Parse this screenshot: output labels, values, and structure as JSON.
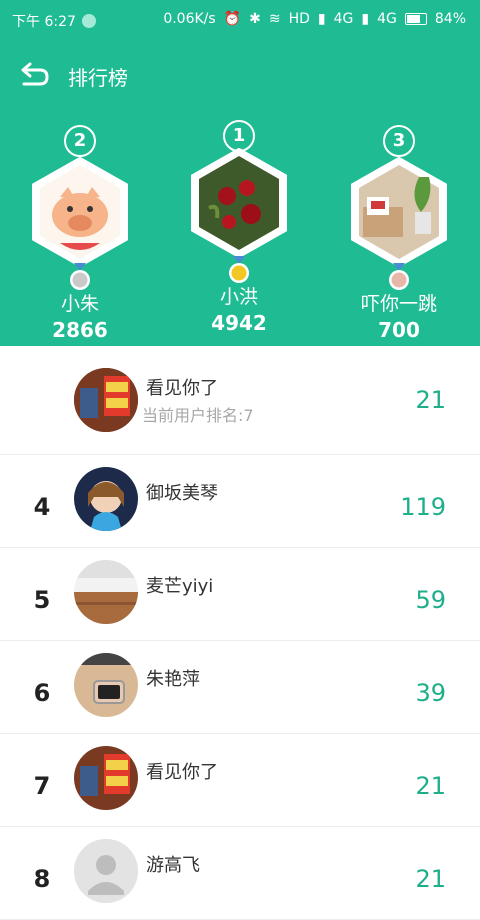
{
  "status_bar": {
    "time": "下午 6:27",
    "speed": "0.06K/s",
    "hd": "HD",
    "net1": "4G",
    "net2": "4G",
    "battery": "84%"
  },
  "header": {
    "title": "排行榜"
  },
  "podium": [
    {
      "rank": "2",
      "name": "小朱",
      "score": "2866",
      "medal": "silver"
    },
    {
      "rank": "1",
      "name": "小洪",
      "score": "4942",
      "medal": "gold"
    },
    {
      "rank": "3",
      "name": "吓你一跳",
      "score": "700",
      "medal": "bronze"
    }
  ],
  "current_user": {
    "name": "看见你了",
    "rank_text": "当前用户排名:7",
    "score": "21"
  },
  "list": [
    {
      "rank": "4",
      "name": "御坂美琴",
      "score": "119"
    },
    {
      "rank": "5",
      "name": "麦芒yiyi",
      "score": "59"
    },
    {
      "rank": "6",
      "name": "朱艳萍",
      "score": "39"
    },
    {
      "rank": "7",
      "name": "看见你了",
      "score": "21"
    },
    {
      "rank": "8",
      "name": "游高飞",
      "score": "21"
    }
  ],
  "colors": {
    "accent": "#1fbc93",
    "score": "#1fae8a",
    "gold": "#f3c623",
    "silver": "#c9c9c9",
    "bronze": "#e8b7a9"
  }
}
